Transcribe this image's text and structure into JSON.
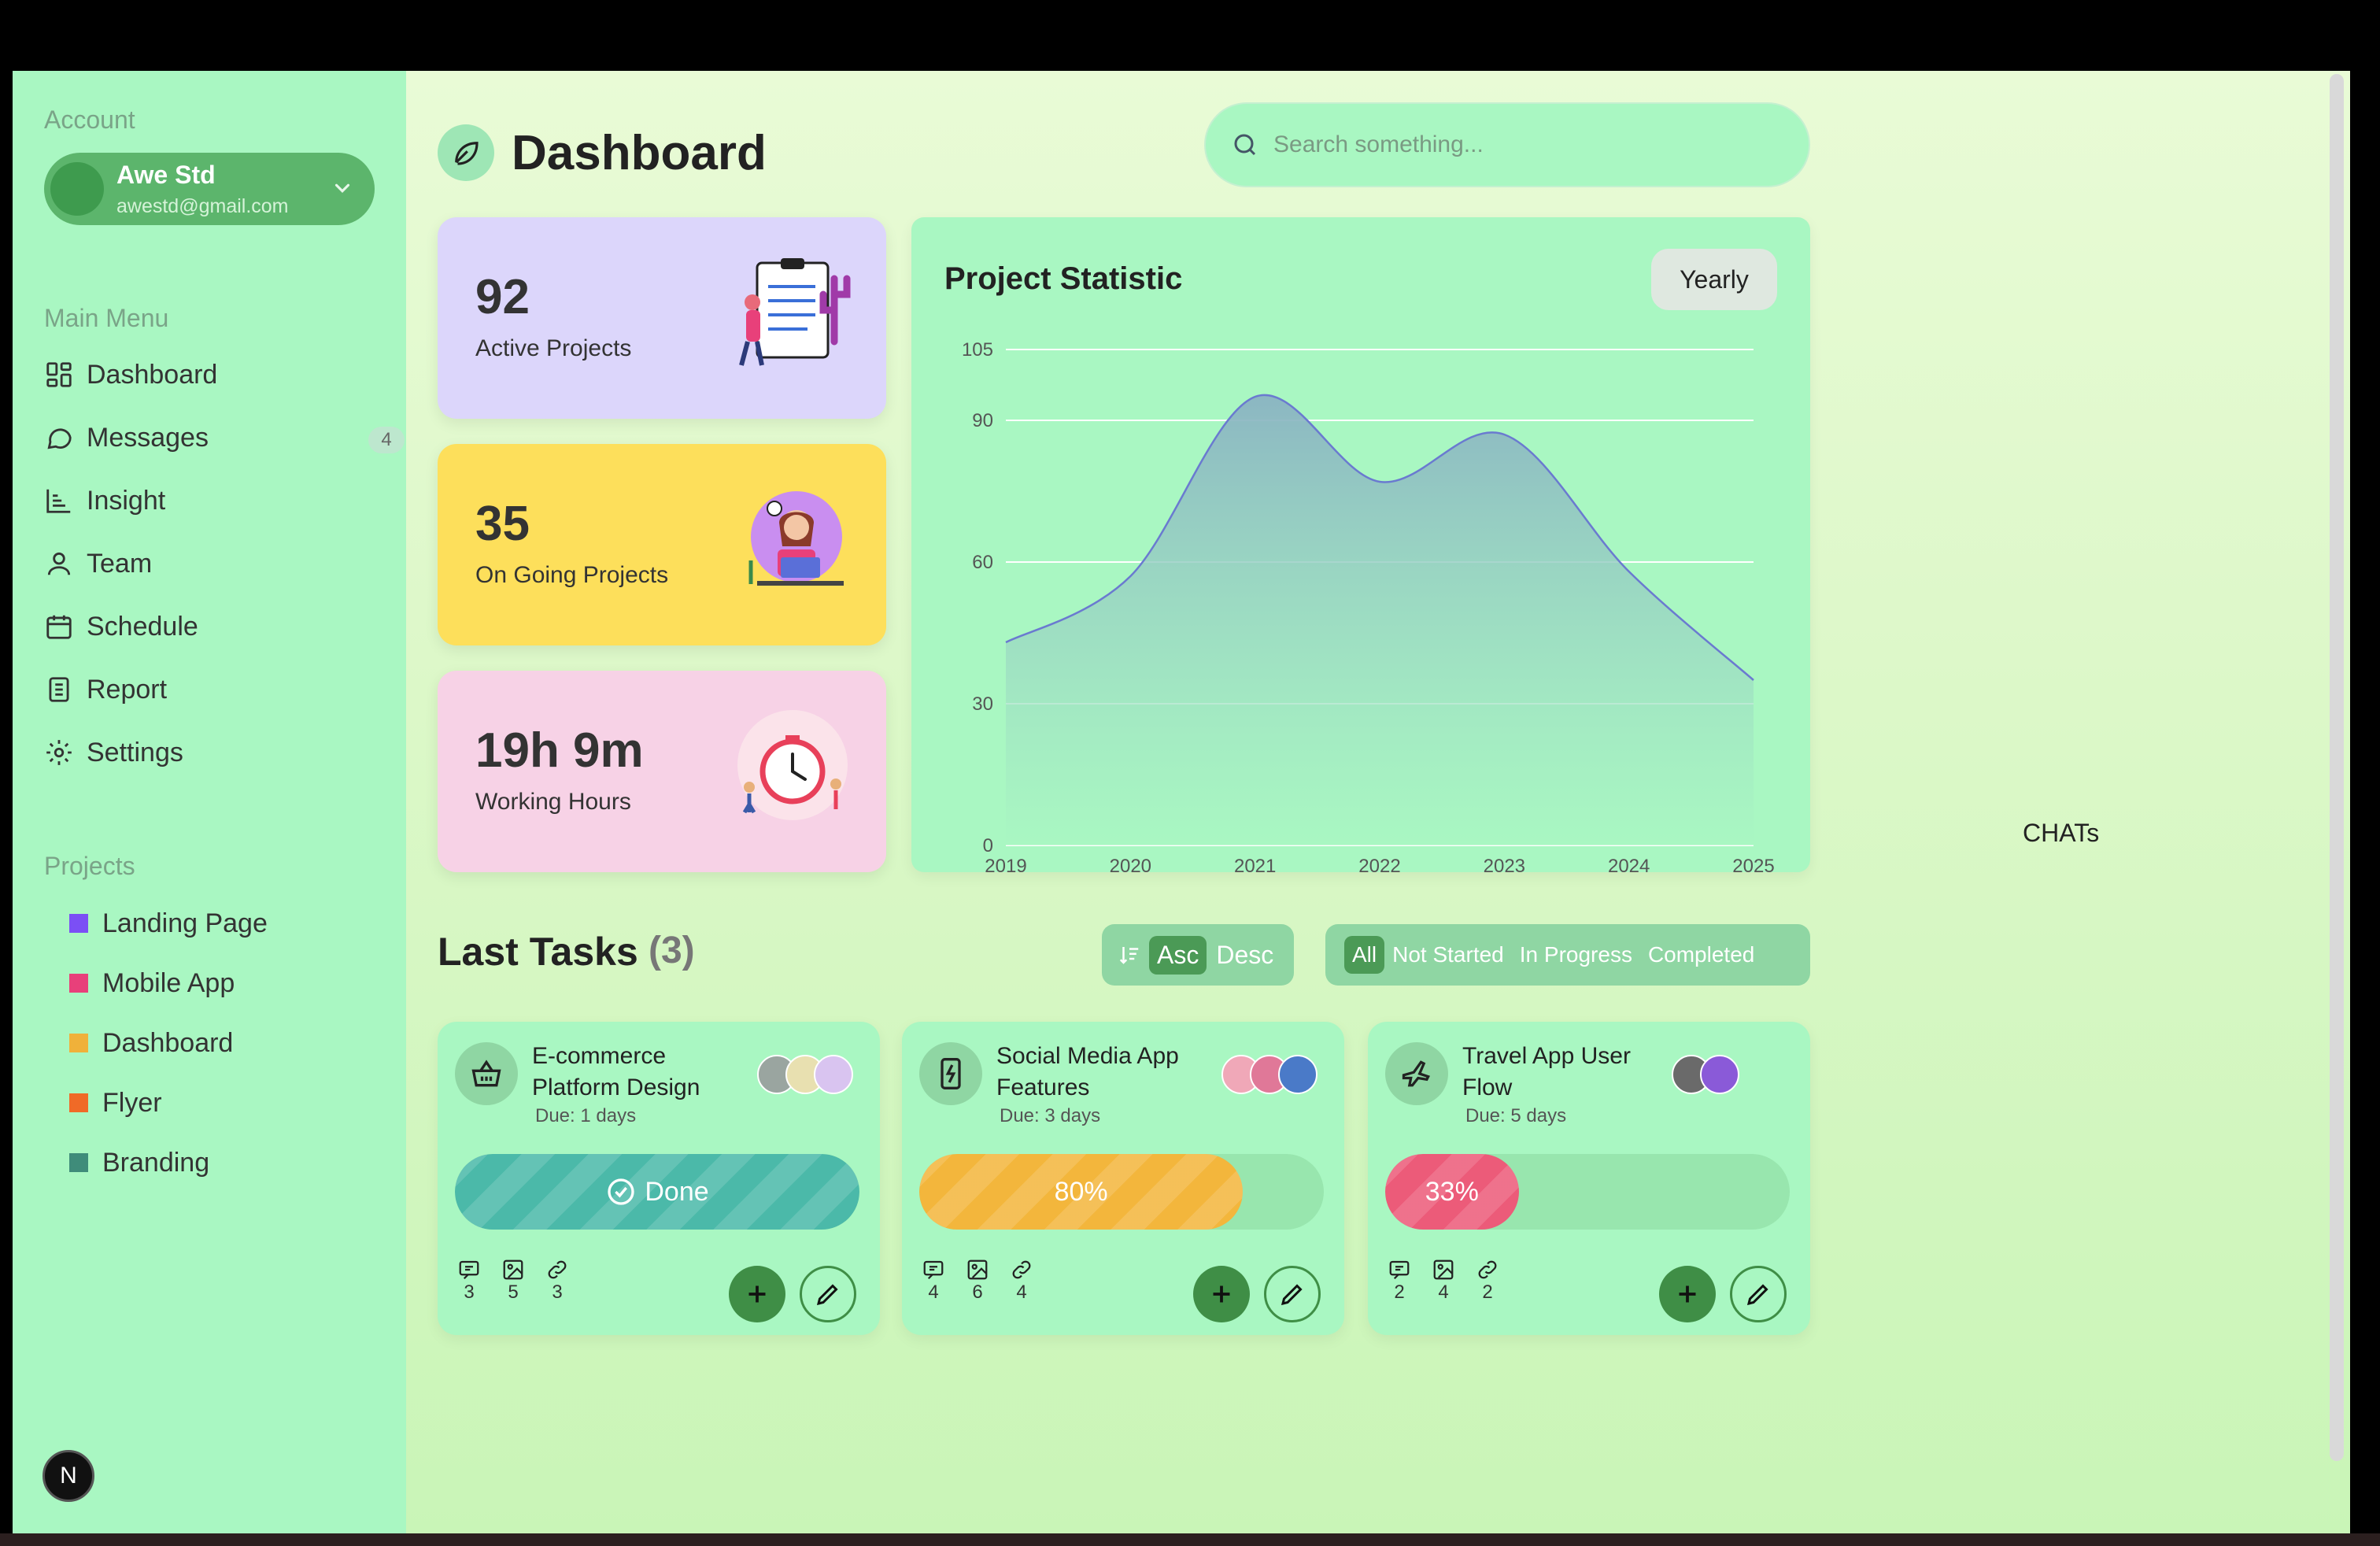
{
  "sidebar": {
    "account_label": "Account",
    "account_name": "Awe Std",
    "account_email": "awestd@gmail.com",
    "main_menu_label": "Main Menu",
    "menu": [
      {
        "label": "Dashboard",
        "icon": "dashboard-icon"
      },
      {
        "label": "Messages",
        "icon": "message-icon",
        "badge": "4"
      },
      {
        "label": "Insight",
        "icon": "insight-icon"
      },
      {
        "label": "Team",
        "icon": "user-icon"
      },
      {
        "label": "Schedule",
        "icon": "calendar-icon"
      },
      {
        "label": "Report",
        "icon": "report-icon"
      },
      {
        "label": "Settings",
        "icon": "gear-icon"
      }
    ],
    "projects_label": "Projects",
    "projects": [
      {
        "label": "Landing Page",
        "color": "#7b4ff5"
      },
      {
        "label": "Mobile App",
        "color": "#e8407a"
      },
      {
        "label": "Dashboard",
        "color": "#f0b13a"
      },
      {
        "label": "Flyer",
        "color": "#f06a27"
      },
      {
        "label": "Branding",
        "color": "#3f8c7a"
      }
    ],
    "bottom_button": "N"
  },
  "header": {
    "title": "Dashboard",
    "search_placeholder": "Search something..."
  },
  "stats": [
    {
      "value": "92",
      "label": "Active Projects",
      "bg": "#dcd6fb"
    },
    {
      "value": "35",
      "label": "On Going Projects",
      "bg": "#fddf5b"
    },
    {
      "value": "19h 9m",
      "label": "Working Hours",
      "bg": "#f7d2e6"
    }
  ],
  "chart": {
    "title": "Project Statistic",
    "period_button": "Yearly"
  },
  "chart_data": {
    "type": "area",
    "title": "Project Statistic",
    "x": [
      "2019",
      "2020",
      "2021",
      "2022",
      "2023",
      "2024",
      "2025"
    ],
    "series": [
      {
        "values": [
          43,
          57,
          95,
          77,
          87,
          58,
          35
        ]
      }
    ],
    "y_ticks": [
      0,
      30,
      60,
      90,
      105
    ],
    "ylim": [
      0,
      105
    ],
    "grid": true
  },
  "chats_label": "CHATs",
  "tasks": {
    "title": "Last Tasks",
    "count": "(3)",
    "sort": {
      "asc": "Asc",
      "desc": "Desc"
    },
    "filters": [
      "All",
      "Not Started",
      "In Progress",
      "Completed"
    ],
    "items": [
      {
        "title": "E-commerce Platform Design",
        "due": "Due: 1 days",
        "icon": "basket-icon",
        "progress_label": "Done",
        "progress": 1.0,
        "color": "#4bb9a9",
        "comments": "3",
        "images": "5",
        "links": "3"
      },
      {
        "title": "Social Media App Features",
        "due": "Due: 3 days",
        "icon": "phone-bolt-icon",
        "progress_label": "80%",
        "progress": 0.8,
        "color": "#f3b63c",
        "comments": "4",
        "images": "6",
        "links": "4"
      },
      {
        "title": "Travel App User Flow",
        "due": "Due: 5 days",
        "icon": "plane-icon",
        "progress_label": "33%",
        "progress": 0.33,
        "color": "#ec5b79",
        "comments": "2",
        "images": "4",
        "links": "2"
      }
    ]
  }
}
